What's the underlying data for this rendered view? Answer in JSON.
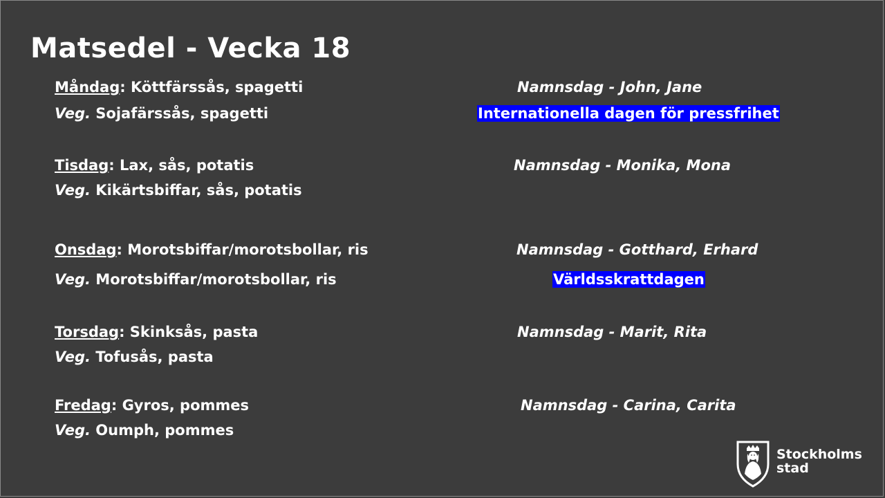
{
  "title": "Matsedel - Vecka 18",
  "days": [
    {
      "day": "Måndag",
      "sep": ": ",
      "dish": "Köttfärssås, spagetti",
      "veg_prefix": "Veg.",
      "veg_dish": " Sojafärssås, spagetti",
      "nameday": "Namnsdag - John, Jane",
      "theme": "Internationella dagen för pressfrihet"
    },
    {
      "day": "Tisdag",
      "sep": ": ",
      "dish": "Lax, sås, potatis",
      "veg_prefix": "Veg.",
      "veg_dish": " Kikärtsbiffar, sås, potatis",
      "nameday": "Namnsdag - Monika, Mona"
    },
    {
      "day": "Onsdag",
      "sep": ": ",
      "dish": "Morotsbiffar/morotsbollar,  ris",
      "veg_prefix": "Veg.",
      "veg_dish": " Morotsbiffar/morotsbollar,  ris",
      "nameday": "Namnsdag - Gotthard, Erhard",
      "theme": "Världsskrattdagen"
    },
    {
      "day": "Torsdag",
      "sep": ": ",
      "dish": "Skinksås, pasta",
      "veg_prefix": "Veg.",
      "veg_dish": " Tofusås, pasta",
      "nameday": "Namnsdag - Marit, Rita"
    },
    {
      "day": "Fredag",
      "sep": ": ",
      "dish": "Gyros, pommes",
      "veg_prefix": "Veg.",
      "veg_dish": " Oumph, pommes",
      "nameday": "Namnsdag - Carina, Carita"
    }
  ],
  "logo": {
    "line1": "Stockholms",
    "line2": "stad",
    "icon": "stockholm-crest-icon"
  },
  "colors": {
    "background": "#3c3c3c",
    "text": "#ffffff",
    "highlight": "#0000ff"
  }
}
